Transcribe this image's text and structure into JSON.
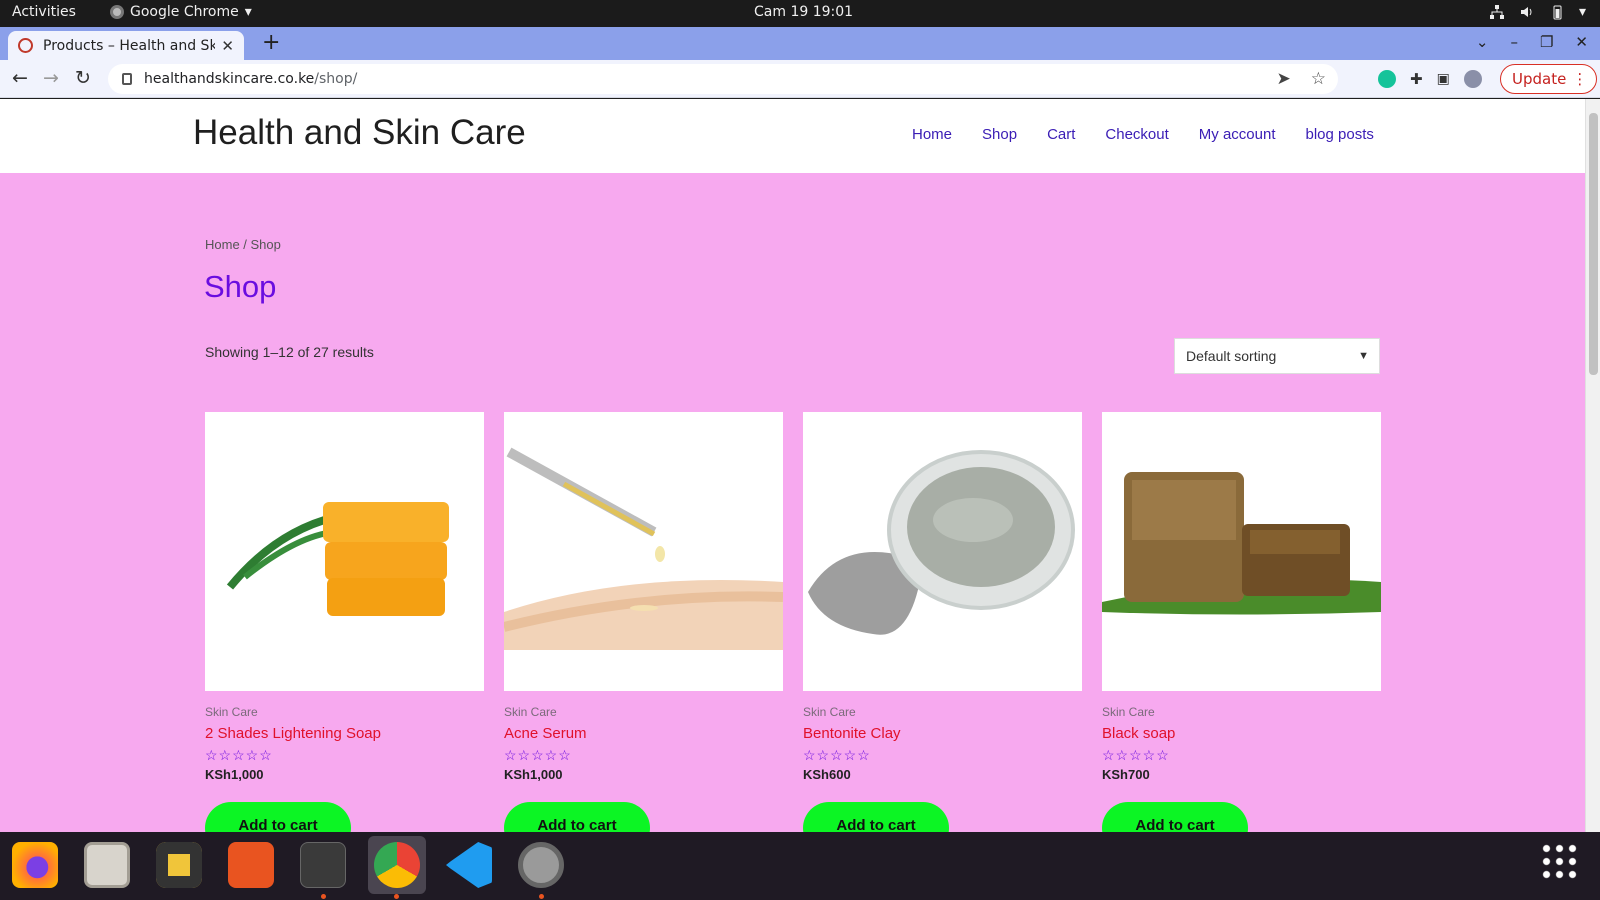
{
  "system": {
    "activities": "Activities",
    "app_name": "Google Chrome",
    "clock": "Cam 19  19:01"
  },
  "browser": {
    "tab_title": "Products – Health and Skin Care",
    "new_tab": "+",
    "url_host": "healthandskincare.co.ke",
    "url_path": "/shop/",
    "update_label": "Update"
  },
  "site": {
    "title": "Health and Skin Care",
    "nav": [
      "Home",
      "Shop",
      "Cart",
      "Checkout",
      "My account",
      "blog posts"
    ]
  },
  "shop": {
    "breadcrumb": "Home / Shop",
    "title": "Shop",
    "result_count": "Showing 1–12 of 27 results",
    "sort_selected": "Default sorting"
  },
  "products": [
    {
      "category": "Skin Care",
      "name": "2 Shades Lightening Soap",
      "price": "KSh1,000",
      "rating": 0,
      "button": "Add to cart"
    },
    {
      "category": "Skin Care",
      "name": "Acne Serum",
      "price": "KSh1,000",
      "rating": 0,
      "button": "Add to cart"
    },
    {
      "category": "Skin Care",
      "name": "Bentonite Clay",
      "price": "KSh600",
      "rating": 0,
      "button": "Add to cart"
    },
    {
      "category": "Skin Care",
      "name": "Black soap",
      "price": "KSh700",
      "rating": 0,
      "button": "Add to cart"
    }
  ],
  "icons": {
    "dock": [
      "firefox-icon",
      "files-icon",
      "rhythmbox-icon",
      "software-icon",
      "terminal-icon",
      "chrome-icon",
      "vscode-icon",
      "settings-icon",
      "app-grid-icon"
    ]
  },
  "colors": {
    "page_bg": "#f7a9ef",
    "accent": "#6a0de0",
    "product_name": "#e0112b",
    "cart_button": "#0cf524"
  }
}
